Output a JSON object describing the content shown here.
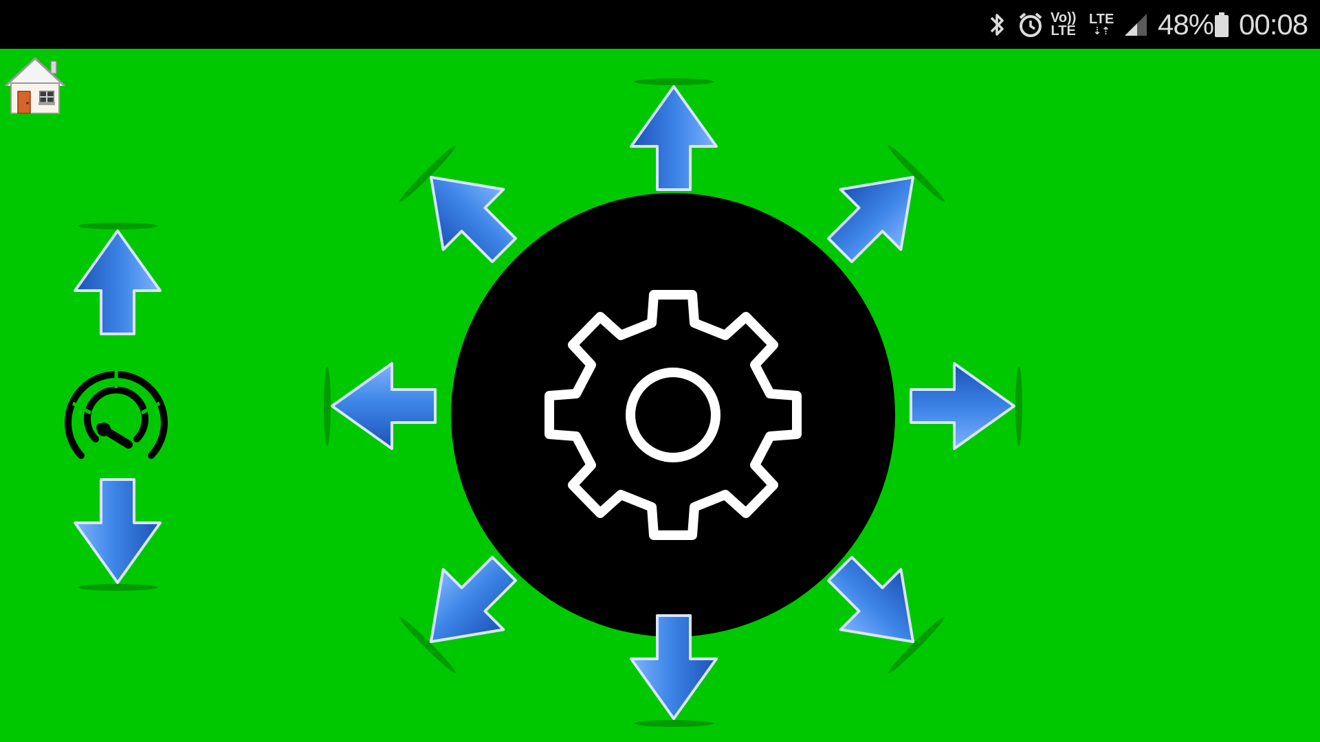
{
  "status_bar": {
    "volte_top": "Vo))",
    "volte_bottom": "LTE",
    "network_label": "LTE",
    "battery_percent": "48%",
    "time": "00:08",
    "icons": [
      "bluetooth-icon",
      "alarm-icon",
      "volte-icon",
      "lte-data-icon",
      "signal-strength-icon",
      "battery-icon"
    ]
  },
  "toolbar": {
    "icons": [
      "home-icon"
    ]
  },
  "speed_controls": {
    "icons": [
      "speed-up-arrow-icon",
      "speedometer-icon",
      "speed-down-arrow-icon"
    ]
  },
  "direction_pad": {
    "directions": [
      "up",
      "up-right",
      "right",
      "down-right",
      "down",
      "down-left",
      "left",
      "up-left"
    ],
    "center_icon": "gear-icon"
  },
  "colors": {
    "background": "#00c800",
    "status_bar": "#000000",
    "arrow_blue": "#2f6fd6",
    "arrow_light": "#8fb8ff",
    "center_panel": "#000000",
    "gear_stroke": "#ffffff"
  }
}
